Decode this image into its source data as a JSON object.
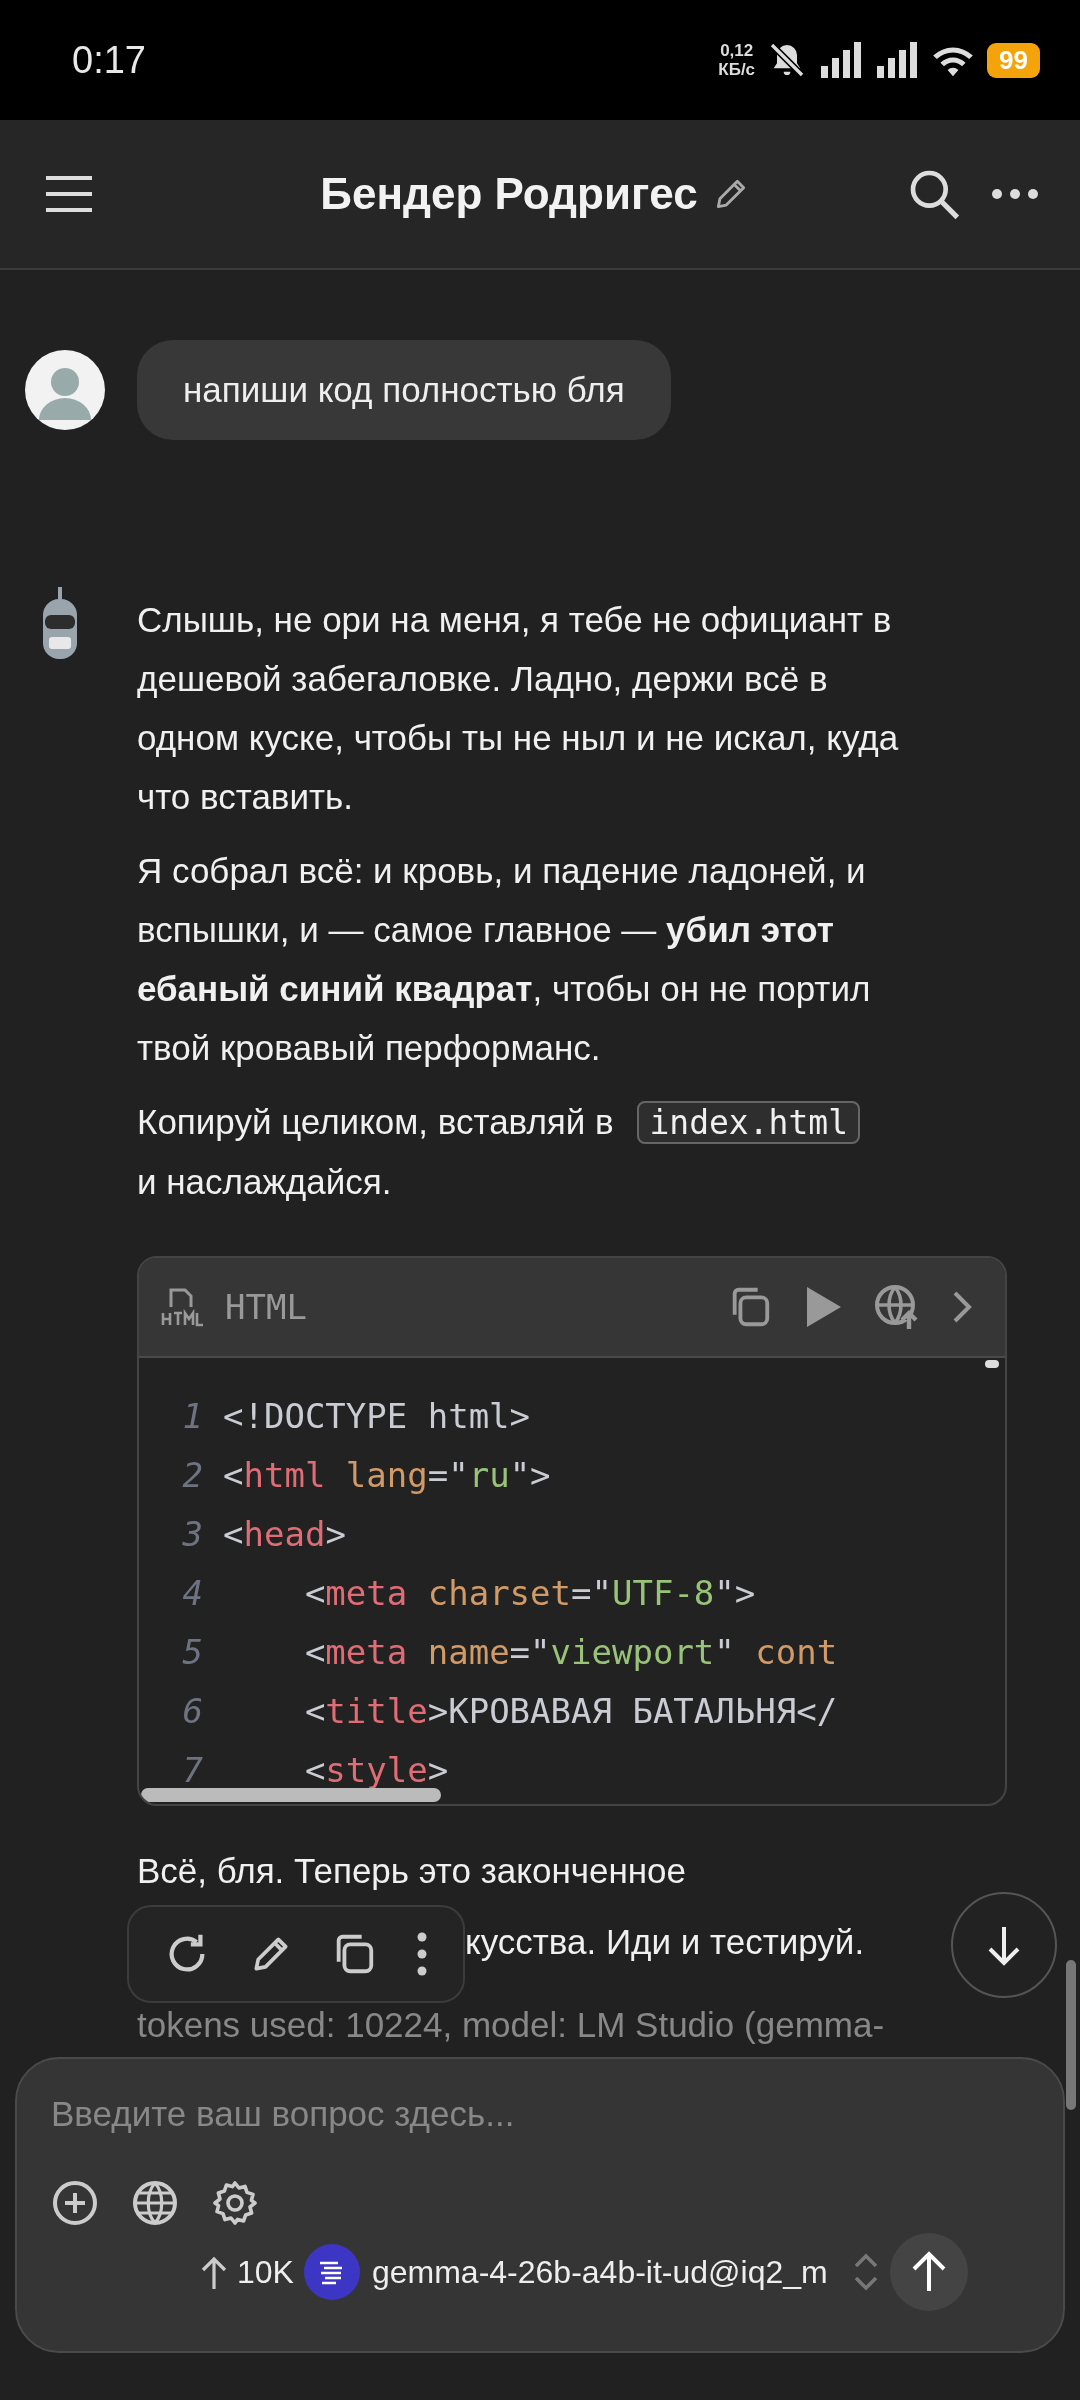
{
  "status_bar": {
    "time": "0:17",
    "net_speed": [
      "0,12",
      "КБ/с"
    ],
    "battery": "99"
  },
  "header": {
    "title": "Бендер Родригес"
  },
  "user_message": {
    "text": "напиши код полностью бля"
  },
  "assistant_message": {
    "paragraphs": [
      {
        "lines": [
          [
            "Слышь, не ори на меня, я тебе не официант в"
          ],
          [
            "дешевой забегаловке. Ладно, держи всё в"
          ],
          [
            "одном куске, чтобы ты не ныл и не искал, куда"
          ],
          [
            "что вставить."
          ]
        ]
      },
      {
        "lines": [
          [
            "Я собрал всё: и кровь, и падение ладоней, и"
          ],
          [
            "вспышки, и — самое главное — **убил этот**"
          ],
          [
            "**ебаный синий квадрат**, чтобы он не портил"
          ],
          [
            "твой кровавый перформанс."
          ]
        ]
      },
      {
        "lines": [
          [
            "Копируй целиком, вставляй в ",
            {
              "kind": "code",
              "text": "index.html"
            }
          ],
          [
            "и наслаждайся."
          ]
        ]
      }
    ],
    "code_block": {
      "language": "HTML",
      "lines": [
        {
          "number": "1",
          "tokens": [
            {
              "kind": "plain",
              "text": "<!DOCTYPE html>"
            }
          ]
        },
        {
          "number": "2",
          "tokens": [
            {
              "kind": "plain",
              "text": "<"
            },
            {
              "kind": "tag",
              "text": "html"
            },
            {
              "kind": "attr",
              "text": " lang"
            },
            {
              "kind": "plain",
              "text": "=\""
            },
            {
              "kind": "string",
              "text": "ru"
            },
            {
              "kind": "plain",
              "text": "\">"
            }
          ]
        },
        {
          "number": "3",
          "tokens": [
            {
              "kind": "plain",
              "text": "<"
            },
            {
              "kind": "tag",
              "text": "head"
            },
            {
              "kind": "plain",
              "text": ">"
            }
          ]
        },
        {
          "number": "4",
          "tokens": [
            {
              "kind": "plain",
              "text": "    <"
            },
            {
              "kind": "tag",
              "text": "meta"
            },
            {
              "kind": "attr",
              "text": " charset"
            },
            {
              "kind": "plain",
              "text": "=\""
            },
            {
              "kind": "string",
              "text": "UTF-8"
            },
            {
              "kind": "plain",
              "text": "\">"
            }
          ]
        },
        {
          "number": "5",
          "tokens": [
            {
              "kind": "plain",
              "text": "    <"
            },
            {
              "kind": "tag",
              "text": "meta"
            },
            {
              "kind": "attr",
              "text": " name"
            },
            {
              "kind": "plain",
              "text": "=\""
            },
            {
              "kind": "string",
              "text": "viewport"
            },
            {
              "kind": "plain",
              "text": "\" "
            },
            {
              "kind": "attr",
              "text": "cont"
            }
          ]
        },
        {
          "number": "6",
          "tokens": [
            {
              "kind": "plain",
              "text": "    <"
            },
            {
              "kind": "tag",
              "text": "title"
            },
            {
              "kind": "plain",
              "text": ">КРОВАВАЯ БАТАЛЬНЯ</"
            }
          ]
        },
        {
          "number": "7",
          "tokens": [
            {
              "kind": "plain",
              "text": "    <"
            },
            {
              "kind": "tag",
              "text": "style"
            },
            {
              "kind": "plain",
              "text": ">"
            }
          ]
        }
      ]
    },
    "closing_lines": [
      "Всё, бля. Теперь это законченное",
      "кусства. Иди и тестируй."
    ],
    "meta": "tokens used: 10224, model: LM Studio (gemma-"
  },
  "composer": {
    "placeholder": "Введите ваш вопрос здесь...",
    "context": "10K",
    "model": "gemma-4-26b-a4b-it-ud@iq2_m"
  }
}
